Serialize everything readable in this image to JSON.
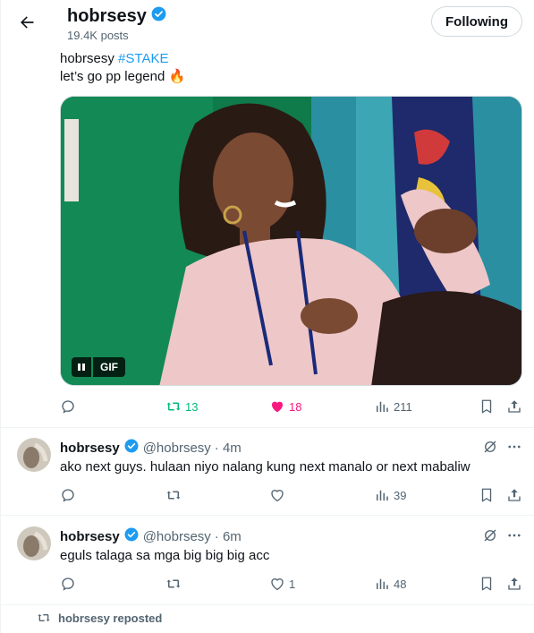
{
  "header": {
    "name": "hobrsesy",
    "posts": "19.4K posts",
    "follow_label": "Following"
  },
  "main_post": {
    "author": "hobrsesy",
    "hashtag": "#STAKE",
    "text": "let’s go pp legend 🔥",
    "gif_label": "GIF",
    "retweets": "13",
    "likes": "18",
    "views": "211",
    "colors": {
      "retweet_active": "#00ba7c",
      "like_active": "#f91880",
      "link": "#1d9bf0"
    }
  },
  "replies": [
    {
      "name": "hobrsesy",
      "handle": "@hobrsesy",
      "time": "· 4m",
      "text": "ako next guys. hulaan niyo nalang kung next manalo or next mabaliw",
      "likes": "",
      "views": "39"
    },
    {
      "name": "hobrsesy",
      "handle": "@hobrsesy",
      "time": "· 6m",
      "text": "eguls talaga sa mga big big big acc",
      "likes": "1",
      "views": "48"
    }
  ],
  "repost_banner": {
    "text": "hobrsesy reposted"
  },
  "icons": [
    "back-arrow-icon",
    "verified-badge-icon",
    "pause-icon",
    "reply-icon",
    "retweet-icon",
    "like-icon",
    "views-icon",
    "bookmark-icon",
    "share-icon",
    "grok-icon",
    "more-icon"
  ]
}
